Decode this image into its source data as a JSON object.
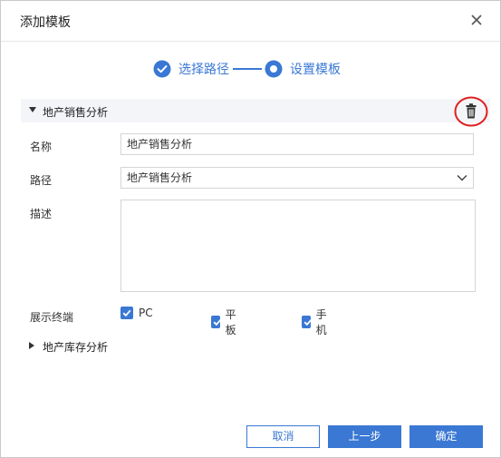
{
  "dialog": {
    "title": "添加模板",
    "close_icon": "close-icon"
  },
  "steps": [
    {
      "label": "选择路径",
      "state": "done"
    },
    {
      "label": "设置模板",
      "state": "current"
    }
  ],
  "section": {
    "title": "地产销售分析",
    "expanded": true,
    "delete_icon": "trash-icon",
    "name_label": "名称",
    "name_value": "地产销售分析",
    "path_label": "路径",
    "path_value": "地产销售分析",
    "desc_label": "描述",
    "desc_value": "",
    "terminal_label": "展示终端",
    "terminals": [
      {
        "label": "PC",
        "checked": true
      },
      {
        "label": "平板",
        "checked": true
      },
      {
        "label": "手机",
        "checked": true
      }
    ]
  },
  "section2": {
    "title": "地产库存分析",
    "expanded": false
  },
  "footer": {
    "cancel_label": "取消",
    "prev_label": "上一步",
    "ok_label": "确定"
  },
  "colors": {
    "accent": "#3a78d4",
    "highlight_ring": "#e02020"
  }
}
